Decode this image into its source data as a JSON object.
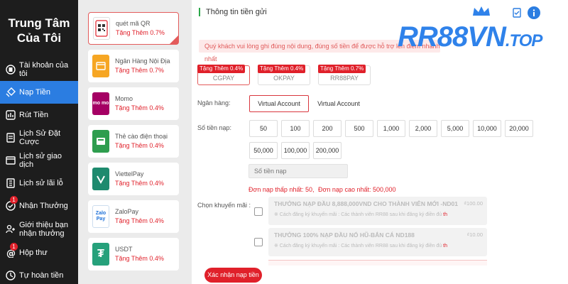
{
  "sidebar": {
    "title_line1": "Trung Tâm",
    "title_line2": "Của Tôi",
    "items": [
      {
        "label": "Tài khoản của tôi",
        "icon": "account-icon"
      },
      {
        "label": "Nạp Tiền",
        "icon": "deposit-icon",
        "active": true
      },
      {
        "label": "Rút Tiền",
        "icon": "withdraw-icon"
      },
      {
        "label": "Lịch Sử Đặt Cược",
        "icon": "bet-history-icon"
      },
      {
        "label": "Lịch sử giao dịch",
        "icon": "transaction-icon"
      },
      {
        "label": "Lịch sử lãi lỗ",
        "icon": "profit-loss-icon"
      },
      {
        "label": "Nhận Thưởng",
        "icon": "reward-icon",
        "badge": "1"
      },
      {
        "label_line1": "Giới thiệu bạn",
        "label_line2": "nhận thưởng",
        "icon": "referral-icon"
      },
      {
        "label": "Hộp thư",
        "icon": "mailbox-icon",
        "badge": "1"
      },
      {
        "label": "Tự hoàn tiền",
        "icon": "cashback-icon"
      }
    ]
  },
  "methods": [
    {
      "name": "quét mã QR",
      "bonus": "Tặng Thêm 0.7%",
      "icon": "qr-icon",
      "selected": true
    },
    {
      "name": "Ngân Hàng Nội Địa",
      "bonus": "Tặng Thêm 0.7%",
      "icon": "bank-icon"
    },
    {
      "name": "Momo",
      "bonus": "Tặng Thêm 0.4%",
      "icon": "momo-icon",
      "icon_text": "mo mo"
    },
    {
      "name": "Thẻ cào điện thoại",
      "bonus": "Tặng Thêm 0.4%",
      "icon": "phone-card-icon"
    },
    {
      "name": "ViettelPay",
      "bonus": "Tặng Thêm 0.4%",
      "icon": "viettelpay-icon"
    },
    {
      "name": "ZaloPay",
      "bonus": "Tặng Thêm 0.4%",
      "icon": "zalopay-icon",
      "icon_text": "Zalo Pay"
    },
    {
      "name": "USDT",
      "bonus": "Tặng Thêm 0.4%",
      "icon": "usdt-icon",
      "icon_text": "₮"
    }
  ],
  "main": {
    "title": "Thông tin tiền gửi",
    "notice": "Quý khách vui lòng ghi đúng nội dung, đúng số tiền để được hỗ trợ lên điểm nhanh nhất",
    "channels": [
      {
        "badge": "Tặng Thêm 0.4%",
        "name": "CGPAY",
        "selected": true
      },
      {
        "badge": "Tặng Thêm 0.4%",
        "name": "OKPAY"
      },
      {
        "badge": "Tặng Thêm 0.7%",
        "name": "RR88PAY"
      }
    ],
    "bank_label": "Ngân hàng:",
    "bank_options": [
      "Virtual Account",
      "Virtual Account"
    ],
    "amount_label": "Số tiền nạp:",
    "amounts": [
      "50",
      "100",
      "200",
      "500",
      "1,000",
      "2,000",
      "5,000",
      "10,000",
      "20,000",
      "50,000",
      "100,000",
      "200,000"
    ],
    "amount_placeholder": "Số tiền nạp",
    "min_label": "Đơn nạp thấp nhất:",
    "min_value": "50,",
    "max_label": "Đơn nạp cao nhất:",
    "max_value": "500,000",
    "promo_label": "Chọn khuyến mãi :",
    "promos": [
      {
        "title": "THƯỞNG NẠP ĐẦU 8,888,000VND CHO THÀNH VIÊN MỚI -ND01",
        "amount": "₫100.00",
        "desc": "※ Cách đăng ký khuyến mãi : Các thành viên RR88 sau khi đăng ký điền đủ ",
        "desc_red": "th"
      },
      {
        "title": "THƯỞNG 100% NẠP ĐẦU NỔ HŨ-BẮN CÁ ND188",
        "amount": "₫10.00",
        "desc": "※ Cách đăng ký khuyến mãi : Các thành viên RR88 sau khi đăng ký điền đủ ",
        "desc_red": "th"
      }
    ],
    "confirm_label": "Xác nhận nạp tiền"
  },
  "logo": {
    "text": "RR88VN",
    "tld": ".TOP"
  },
  "colors": {
    "accent": "#2b7de1",
    "red": "#e0202a",
    "sidebar_bg": "#1d1d1d",
    "logo_blue": "#2f82ea"
  }
}
